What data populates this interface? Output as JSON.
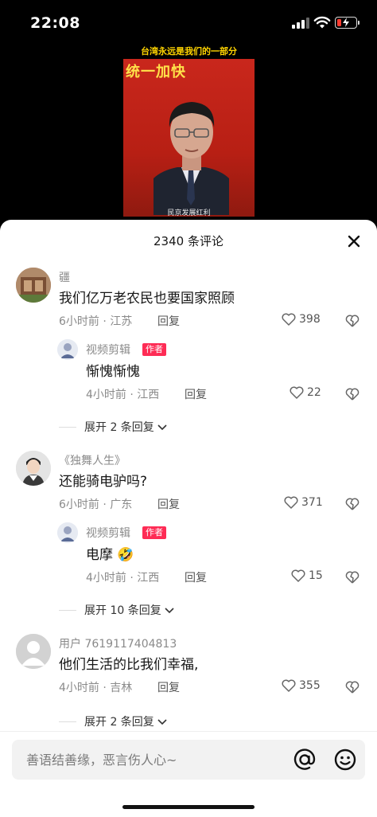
{
  "status_bar": {
    "time": "22:08"
  },
  "video": {
    "caption_top": "台湾永远是我们的一部分",
    "caption_main": "统一加快",
    "caption_bottom": "民京发展红利"
  },
  "sheet": {
    "title": "2340 条评论"
  },
  "comments": [
    {
      "username": "疆",
      "text": "我们亿万老农民也要国家照顾",
      "time_location": "6小时前 · 江苏",
      "reply_label": "回复",
      "likes": "398",
      "replies": [
        {
          "username": "视频剪辑",
          "badge": "作者",
          "text": "惭愧惭愧",
          "time_location": "4小时前 · 江西",
          "reply_label": "回复",
          "likes": "22"
        }
      ],
      "expand_label": "展开 2 条回复"
    },
    {
      "username": "《独舞人生》",
      "text": "还能骑电驴吗?",
      "time_location": "6小时前 · 广东",
      "reply_label": "回复",
      "likes": "371",
      "replies": [
        {
          "username": "视频剪辑",
          "badge": "作者",
          "text": "电摩",
          "emoji": "🤣",
          "time_location": "4小时前 · 江西",
          "reply_label": "回复",
          "likes": "15"
        }
      ],
      "expand_label": "展开 10 条回复"
    },
    {
      "username": "用户 7619117404813",
      "text": "他们生活的比我们幸福,",
      "time_location": "4小时前 · 吉林",
      "reply_label": "回复",
      "likes": "355",
      "expand_label": "展开 2 条回复"
    }
  ],
  "input": {
    "placeholder": "善语结善缘，恶言伤人心~"
  },
  "colors": {
    "author_badge": "#fe2c55",
    "sheet_bg": "#ffffff",
    "video_bg": "#c9271c"
  },
  "icons": [
    "signal-icon",
    "wifi-icon",
    "battery-icon",
    "close-icon",
    "heart-icon",
    "broken-heart-icon",
    "chevron-down-icon",
    "at-icon",
    "emoji-icon"
  ]
}
